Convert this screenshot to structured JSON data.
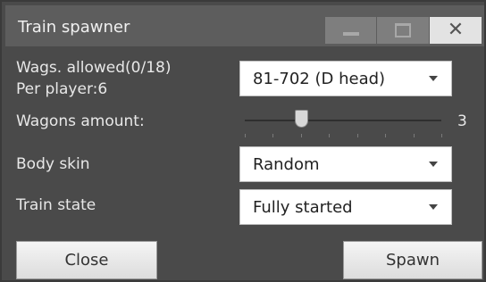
{
  "window": {
    "title": "Train spawner"
  },
  "labels": {
    "wags_allowed": "Wags. allowed(0/18)",
    "per_player": "Per player:6",
    "wagons_amount": "Wagons amount:",
    "body_skin": "Body skin",
    "train_state": "Train state"
  },
  "fields": {
    "train_model": "81-702 (D head)",
    "body_skin": "Random",
    "train_state": "Fully started"
  },
  "slider": {
    "value": "3",
    "min": 1,
    "max": 8,
    "level": 3
  },
  "buttons": {
    "close": "Close",
    "spawn": "Spawn"
  }
}
